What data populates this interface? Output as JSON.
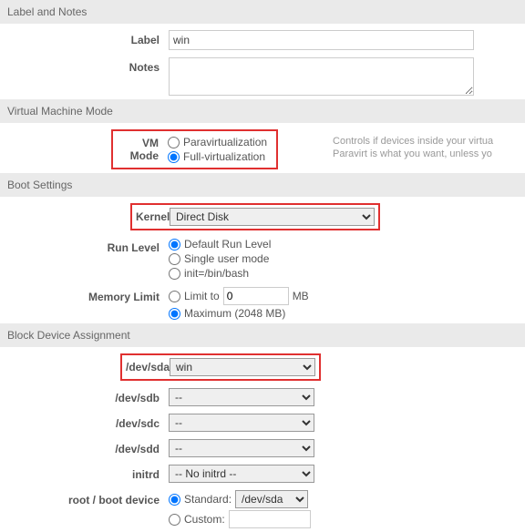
{
  "sections": {
    "label_notes": "Label and Notes",
    "vm_mode": "Virtual Machine Mode",
    "boot": "Boot Settings",
    "block": "Block Device Assignment"
  },
  "labels": {
    "label": "Label",
    "notes": "Notes",
    "vmmode": "VM Mode",
    "kernel": "Kernel",
    "runlevel": "Run Level",
    "memlimit": "Memory Limit",
    "sda": "/dev/sda",
    "sdb": "/dev/sdb",
    "sdc": "/dev/sdc",
    "sdd": "/dev/sdd",
    "initrd": "initrd",
    "rootboot": "root / boot device"
  },
  "values": {
    "label": "win",
    "notes": "",
    "kernel": "Direct Disk",
    "sda": "win",
    "sdb": "--",
    "sdc": "--",
    "sdd": "--",
    "initrd": "-- No initrd --",
    "limit_to": "0",
    "rootdev": "/dev/sda",
    "custom": ""
  },
  "options": {
    "vm_para": "Paravirtualization",
    "vm_full": "Full-virtualization",
    "run_default": "Default Run Level",
    "run_single": "Single user mode",
    "run_init": "init=/bin/bash",
    "mem_limit": "Limit to",
    "mem_mb": "MB",
    "mem_max": "Maximum (2048 MB)",
    "root_standard": "Standard:",
    "root_custom": "Custom:"
  },
  "hint": {
    "vm1": "Controls if devices inside your virtua",
    "vm2": "Paravirt is what you want, unless yo"
  }
}
